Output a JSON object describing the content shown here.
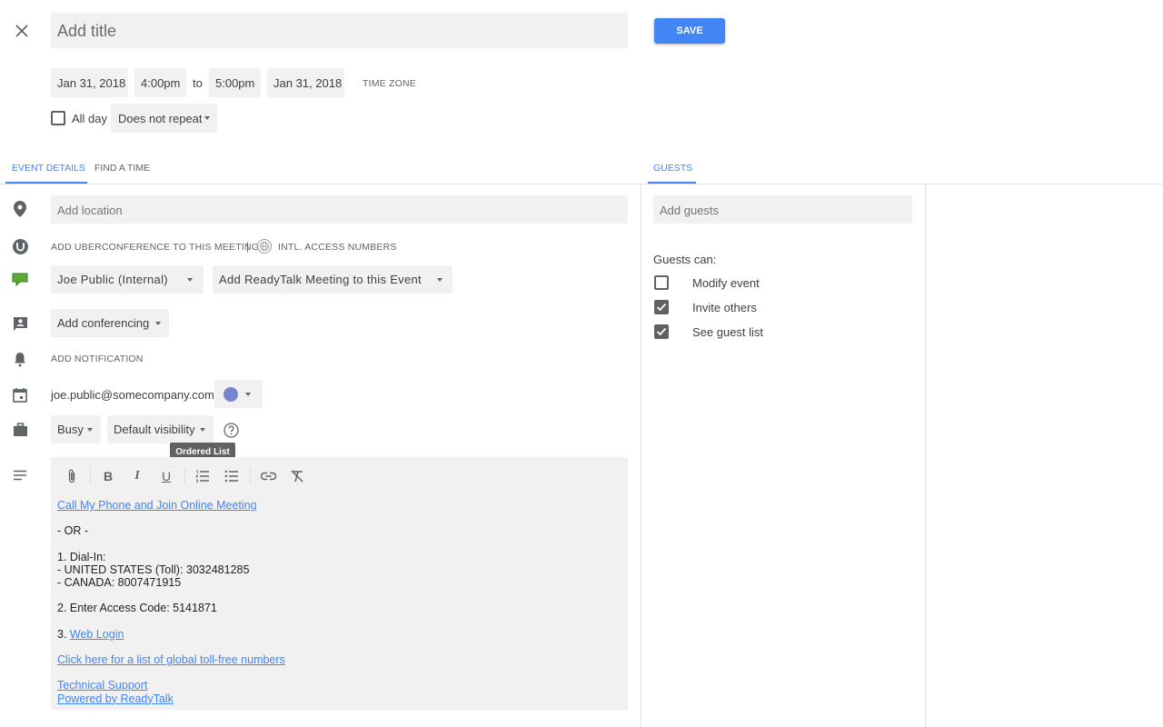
{
  "header": {
    "close_label": "Close",
    "title_placeholder": "Add title",
    "save_label": "SAVE",
    "start_date": "Jan 31, 2018",
    "start_time": "4:00pm",
    "to_label": "to",
    "end_time": "5:00pm",
    "end_date": "Jan 31, 2018",
    "timezone_label": "TIME ZONE",
    "all_day_label": "All day",
    "all_day_checked": false,
    "repeat_value": "Does not repeat"
  },
  "tabs": {
    "left": [
      {
        "label": "EVENT DETAILS",
        "active": true
      },
      {
        "label": "FIND A TIME",
        "active": false
      }
    ],
    "right": [
      {
        "label": "GUESTS",
        "active": true
      }
    ]
  },
  "details": {
    "location_placeholder": "Add location",
    "uberconference_label": "ADD UBERCONFERENCE TO THIS MEETING",
    "separator": "|",
    "intl_access_label": "INTL. ACCESS NUMBERS",
    "readytalk_account": "Joe Public (Internal)",
    "readytalk_action": "Add ReadyTalk Meeting to this Event",
    "conferencing_value": "Add conferencing",
    "notification_label": "ADD NOTIFICATION",
    "calendar_email": "joe.public@somecompany.com",
    "calendar_color": "#7986cb",
    "availability_value": "Busy",
    "visibility_value": "Default visibility",
    "tooltip": "Ordered List"
  },
  "editor": {
    "toolbar": [
      "attachment",
      "bold",
      "italic",
      "underline",
      "ordered-list",
      "unordered-list",
      "link",
      "clear-formatting"
    ],
    "content": {
      "call_link": "Call My Phone and Join Online Meeting",
      "or_text": "- OR -",
      "dial_in": "1. Dial-In:",
      "us_number": "- UNITED STATES (Toll): 3032481285",
      "canada_number": "- CANADA: 8007471915",
      "access_code": "2. Enter Access Code: 5141871",
      "step3_prefix": "3. ",
      "web_login": "Web Login",
      "global_link": "Click here for a list of global toll-free numbers",
      "tech_support": "Technical Support",
      "powered_by": "Powered by ReadyTalk"
    }
  },
  "guests": {
    "add_placeholder": "Add guests",
    "permissions_label": "Guests can:",
    "permissions": [
      {
        "label": "Modify event",
        "checked": false
      },
      {
        "label": "Invite others",
        "checked": true
      },
      {
        "label": "See guest list",
        "checked": true
      }
    ]
  },
  "colors": {
    "accent": "#4285f4",
    "field_bg": "#f1f1f1"
  }
}
